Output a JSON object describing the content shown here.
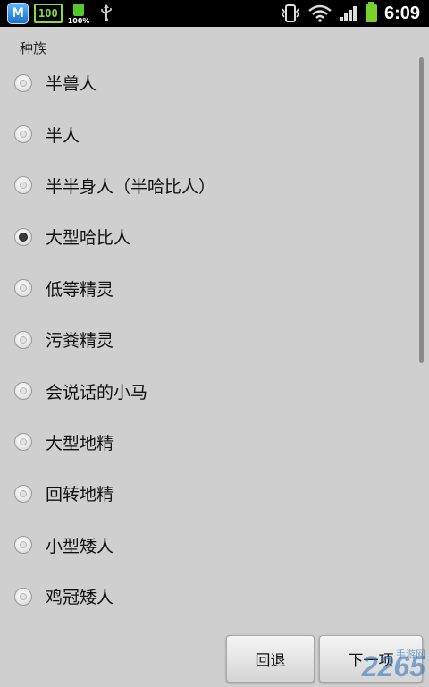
{
  "status_bar": {
    "app_badge": "M",
    "battery_badge": "100",
    "small_battery_pct": "100%",
    "time": "6:09"
  },
  "section_title": "种族",
  "options": [
    {
      "label": "半兽人",
      "selected": false
    },
    {
      "label": "半人",
      "selected": false
    },
    {
      "label": "半半身人（半哈比人）",
      "selected": false
    },
    {
      "label": "大型哈比人",
      "selected": true
    },
    {
      "label": "低等精灵",
      "selected": false
    },
    {
      "label": "污粪精灵",
      "selected": false
    },
    {
      "label": "会说话的小马",
      "selected": false
    },
    {
      "label": "大型地精",
      "selected": false
    },
    {
      "label": "回转地精",
      "selected": false
    },
    {
      "label": "小型矮人",
      "selected": false
    },
    {
      "label": "鸡冠矮人",
      "selected": false
    }
  ],
  "buttons": {
    "back": "回退",
    "next": "下一项"
  },
  "watermark": {
    "main": "2265",
    "sub": "手游网"
  }
}
